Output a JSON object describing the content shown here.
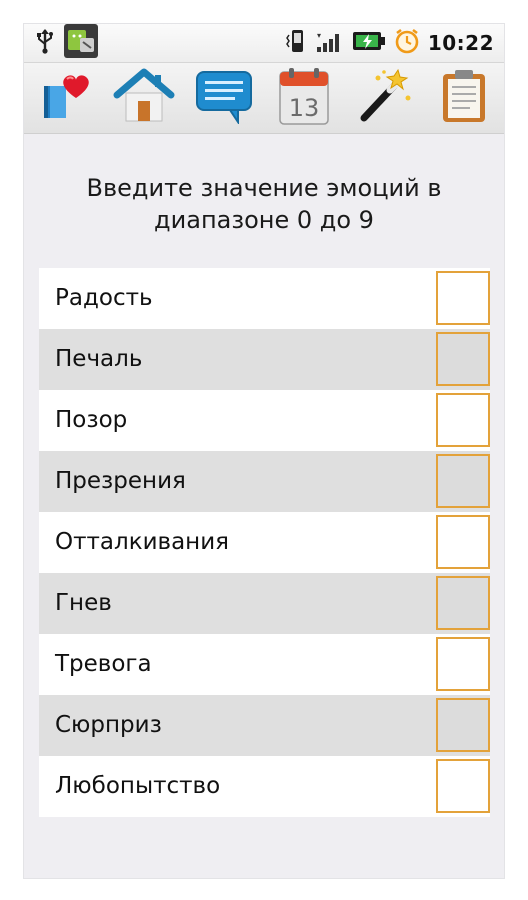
{
  "statusbar": {
    "time": "10:22",
    "icons": [
      "usb-icon",
      "android-notification-icon",
      "phone-vibrate-icon",
      "signal-icon",
      "battery-charging-icon",
      "alarm-icon"
    ]
  },
  "toolbar": {
    "buttons": [
      {
        "name": "heart-book-button",
        "icon": "heart-book-icon"
      },
      {
        "name": "home-button",
        "icon": "home-icon"
      },
      {
        "name": "message-button",
        "icon": "speech-bubble-icon"
      },
      {
        "name": "calendar-button",
        "icon": "calendar-icon",
        "day": "13"
      },
      {
        "name": "magic-wand-button",
        "icon": "magic-wand-icon"
      },
      {
        "name": "clipboard-button",
        "icon": "clipboard-icon"
      }
    ]
  },
  "main": {
    "title_line1": "Введите значение эмоций в",
    "title_line2": "диапазоне 0 до 9",
    "emotions": [
      {
        "label": "Радость",
        "value": ""
      },
      {
        "label": "Печаль",
        "value": ""
      },
      {
        "label": "Позор",
        "value": ""
      },
      {
        "label": "Презрения",
        "value": ""
      },
      {
        "label": "Отталкивания",
        "value": ""
      },
      {
        "label": "Гнев",
        "value": ""
      },
      {
        "label": "Тревога",
        "value": ""
      },
      {
        "label": "Сюрприз",
        "value": ""
      },
      {
        "label": "Любопытство",
        "value": ""
      }
    ]
  },
  "colors": {
    "input_border": "#e3a23a",
    "row_alt": "#dfdfdf",
    "background": "#efeef2"
  }
}
